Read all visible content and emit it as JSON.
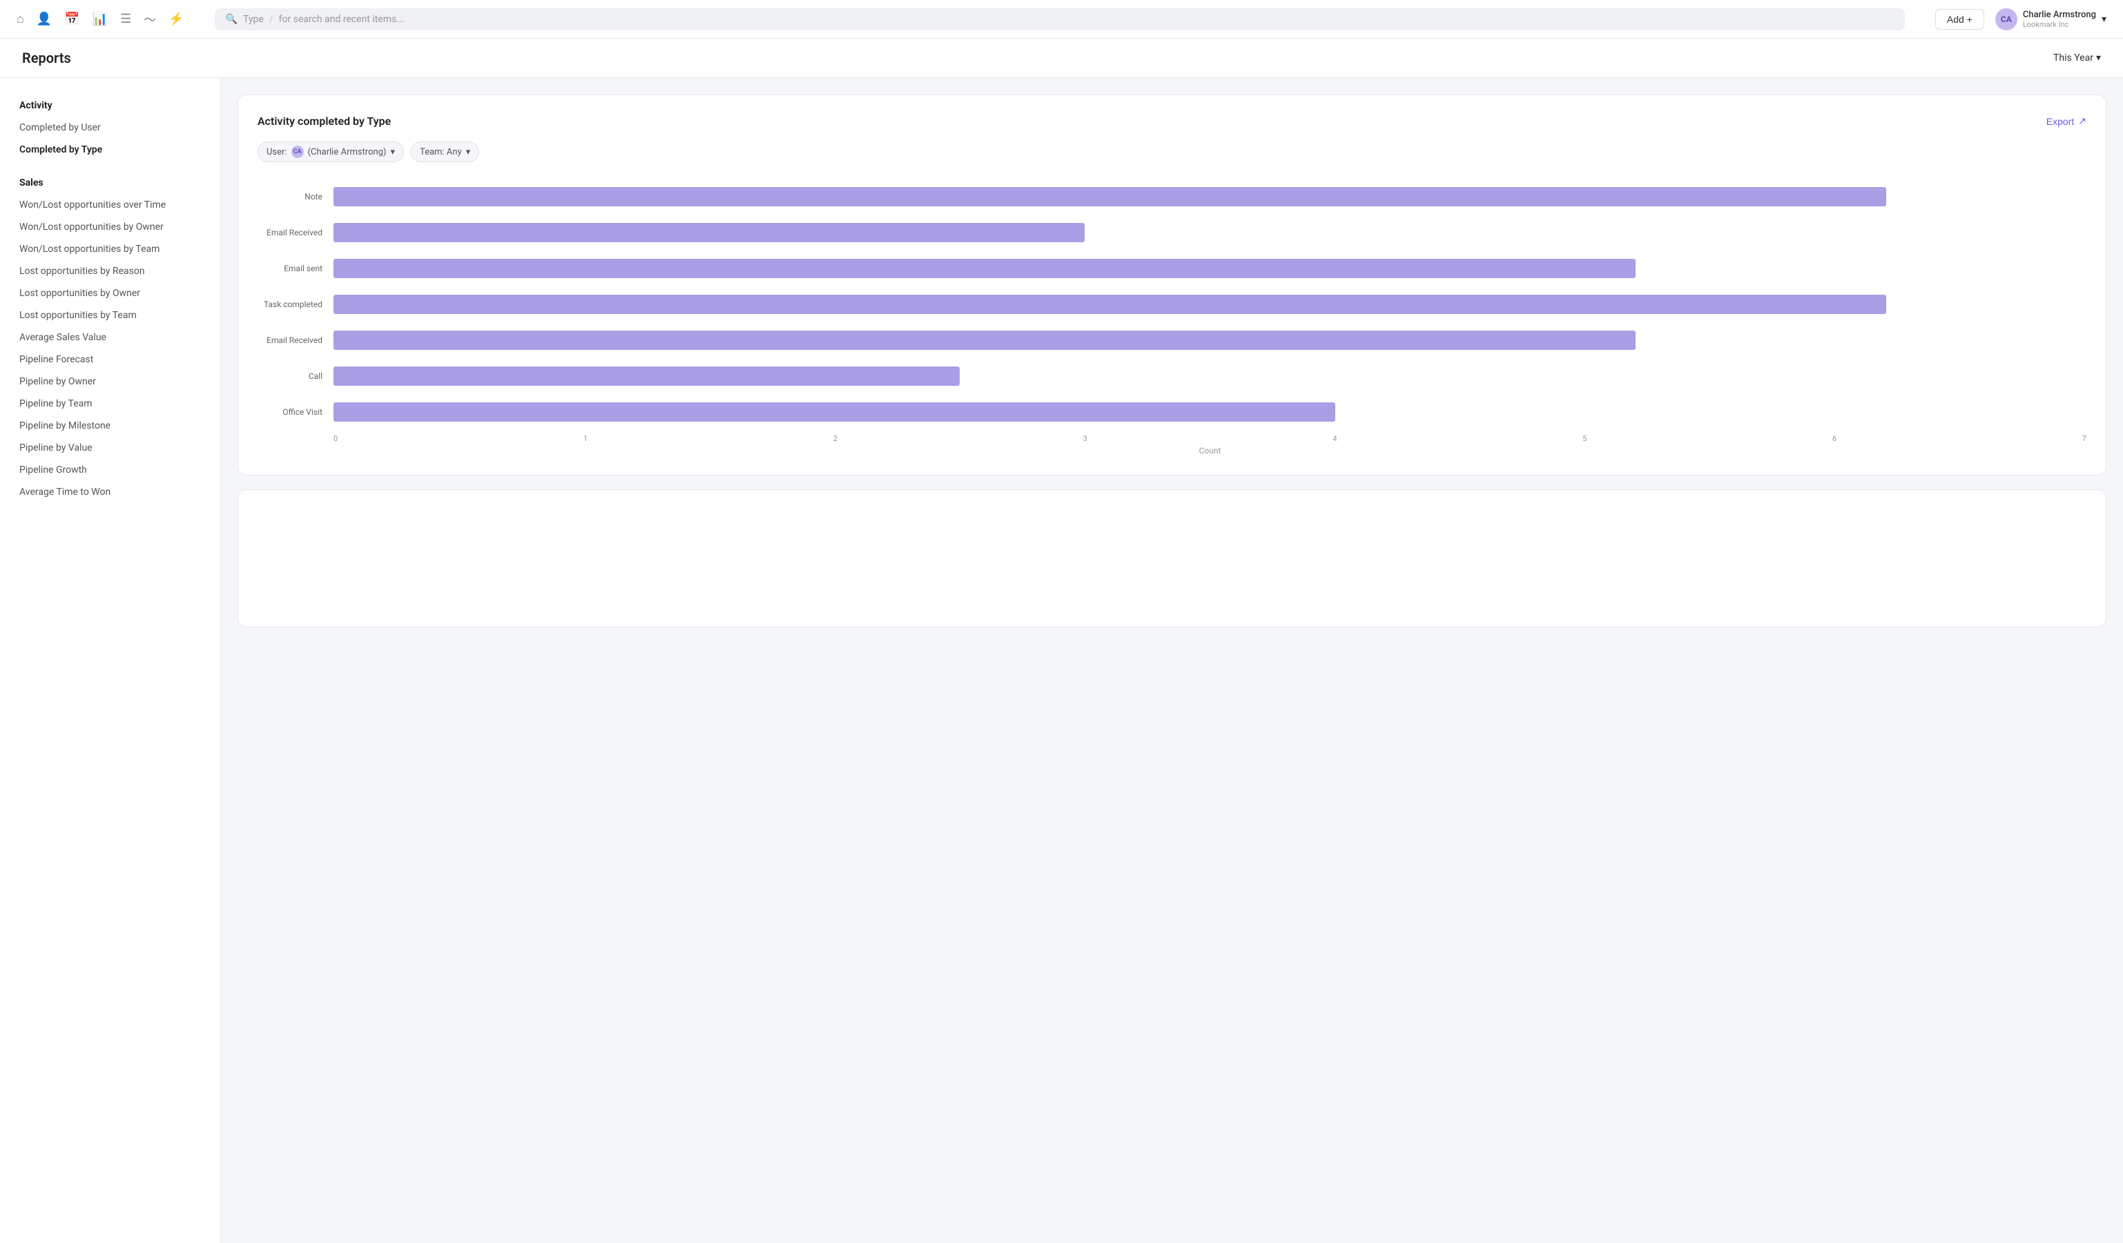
{
  "nav": {
    "search_placeholder": "for search and recent items...",
    "search_type": "Type",
    "add_button": "Add +",
    "user_initials": "CA",
    "user_name": "Charlie Armstrong",
    "user_company": "Lookmark Inc"
  },
  "page": {
    "title": "Reports",
    "period": "This Year",
    "period_icon": "▾"
  },
  "sidebar": {
    "activity_section": "Activity",
    "sales_section": "Sales",
    "items": {
      "completed_by_user": "Completed by User",
      "completed_by_type": "Completed by Type",
      "won_lost_over_time": "Won/Lost opportunities over Time",
      "won_lost_by_owner": "Won/Lost opportunities by Owner",
      "won_lost_by_team": "Won/Lost opportunities by Team",
      "lost_by_reason": "Lost opportunities by Reason",
      "lost_by_owner": "Lost opportunities by Owner",
      "lost_by_team": "Lost opportunities by Team",
      "avg_sales_value": "Average Sales Value",
      "pipeline_forecast": "Pipeline Forecast",
      "pipeline_by_owner": "Pipeline by Owner",
      "pipeline_by_team": "Pipeline by Team",
      "pipeline_by_milestone": "Pipeline by Milestone",
      "pipeline_by_value": "Pipeline by Value",
      "pipeline_growth": "Pipeline Growth",
      "avg_time_to_won": "Average Time to Won"
    }
  },
  "chart": {
    "title": "Activity completed by Type",
    "export_label": "Export",
    "filter_user_label": "User:",
    "filter_user_value": "(Charlie Armstrong)",
    "filter_team_label": "Team: Any",
    "x_axis_label": "Count",
    "max_value": 7,
    "tick_labels": [
      "0",
      "1",
      "2",
      "3",
      "4",
      "5",
      "6",
      "7"
    ],
    "bars": [
      {
        "label": "Note",
        "value": 6.2
      },
      {
        "label": "Email Received",
        "value": 3.0
      },
      {
        "label": "Email sent",
        "value": 5.2
      },
      {
        "label": "Task completed",
        "value": 6.2
      },
      {
        "label": "Email Received",
        "value": 5.2
      },
      {
        "label": "Call",
        "value": 2.5
      },
      {
        "label": "Office Visit",
        "value": 4.0
      }
    ]
  }
}
